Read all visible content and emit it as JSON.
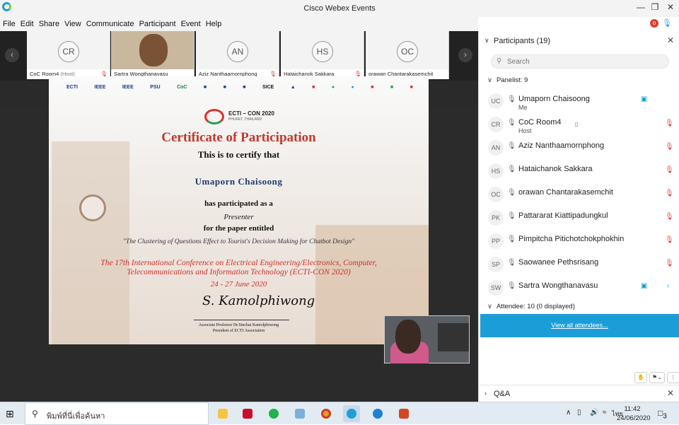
{
  "window": {
    "title": "Cisco Webex Events"
  },
  "menu": [
    "File",
    "Edit",
    "Share",
    "View",
    "Communicate",
    "Participant",
    "Event",
    "Help"
  ],
  "recording_badge": "o",
  "thumbnails": [
    {
      "initials": "CR",
      "name": "CoC Room4",
      "suffix": " (Host)",
      "video": false
    },
    {
      "initials": "",
      "name": "Sartra Wongthanavasu",
      "suffix": "",
      "video": true
    },
    {
      "initials": "AN",
      "name": "Aziz Nanthaamornphong",
      "suffix": "",
      "video": false
    },
    {
      "initials": "HS",
      "name": "Hataichanok Sakkara",
      "suffix": "",
      "video": false
    },
    {
      "initials": "OC",
      "name": "orawan Chantarakasemchit",
      "suffix": "",
      "video": false
    }
  ],
  "certificate": {
    "logos": [
      "ECTI",
      "IEEE",
      "IEEE",
      "PSU",
      "CoC",
      "",
      "",
      "",
      "SICE",
      "",
      "",
      "",
      "",
      "",
      "",
      ""
    ],
    "conf_logo": "ECTI – CON 2020",
    "conf_location": "PHUKET, THAILAND",
    "title": "Certificate of Participation",
    "certify": "This is to certify that",
    "recipient": "Umaporn Chaisoong",
    "has_participated": "has participated as a",
    "role": "Presenter",
    "paper_entitled": "for the paper entitled",
    "paper_title": "\"The Clustering of Questions Effect to Tourist's Decision Making for Chatbot Design\"",
    "conference": "The 17th International Conference on Electrical Engineering/Electronics, Computer, Telecommunications and Information Technology (ECTI-CON 2020)",
    "dates": "24 - 27 June 2020",
    "signature": "S. Kamolphiwong",
    "signer_title": "Associate Professor Dr.Sinchai Kamolphiwong",
    "signer_role": "President of ECTI Association"
  },
  "panel": {
    "title": "Participants (19)",
    "search_placeholder": "Search",
    "panelist_header": "Panelist: 9",
    "panelists": [
      {
        "initials": "UC",
        "name": "Umaporn Chaisoong",
        "sub": "Me",
        "video": true,
        "muted": false
      },
      {
        "initials": "CR",
        "name": "CoC Room4",
        "sub": "Host",
        "video": false,
        "muted": true
      },
      {
        "initials": "AN",
        "name": "Aziz Nanthaamornphong",
        "sub": "",
        "video": false,
        "muted": true
      },
      {
        "initials": "HS",
        "name": "Hataichanok Sakkara",
        "sub": "",
        "video": false,
        "muted": true
      },
      {
        "initials": "OC",
        "name": "orawan Chantarakasemchit",
        "sub": "",
        "video": false,
        "muted": true
      },
      {
        "initials": "PK",
        "name": "Pattararat Kiattipadungkul",
        "sub": "",
        "video": false,
        "muted": true
      },
      {
        "initials": "PP",
        "name": "Pimpitcha Pitichotchokphokhin",
        "sub": "",
        "video": false,
        "muted": true
      },
      {
        "initials": "SP",
        "name": "Saowanee Pethsrisang",
        "sub": "",
        "video": false,
        "muted": true
      },
      {
        "initials": "SW",
        "name": "Sartra Wongthanavasu",
        "sub": "",
        "video": true,
        "muted": false
      }
    ],
    "attendee_header": "Attendee: 10 (0 displayed)",
    "view_all": "View all attendees...",
    "qa_label": "Q&A"
  },
  "taskbar": {
    "search_text": "พิมพ์ที่นี่เพื่อค้นหา",
    "time": "11:42",
    "date": "24/06/2020",
    "notification_count": "3"
  },
  "colors": {
    "accent": "#1b9ed8",
    "mute": "#e03c31",
    "cert_title": "#c0392b"
  }
}
